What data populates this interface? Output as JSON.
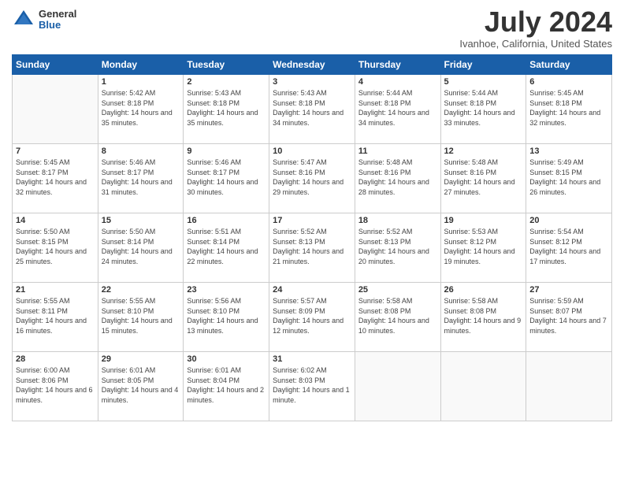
{
  "header": {
    "logo": {
      "general": "General",
      "blue": "Blue"
    },
    "title": "July 2024",
    "location": "Ivanhoe, California, United States"
  },
  "days_of_week": [
    "Sunday",
    "Monday",
    "Tuesday",
    "Wednesday",
    "Thursday",
    "Friday",
    "Saturday"
  ],
  "weeks": [
    [
      {
        "num": "",
        "sunrise": "",
        "sunset": "",
        "daylight": "",
        "empty": true
      },
      {
        "num": "1",
        "sunrise": "Sunrise: 5:42 AM",
        "sunset": "Sunset: 8:18 PM",
        "daylight": "Daylight: 14 hours and 35 minutes."
      },
      {
        "num": "2",
        "sunrise": "Sunrise: 5:43 AM",
        "sunset": "Sunset: 8:18 PM",
        "daylight": "Daylight: 14 hours and 35 minutes."
      },
      {
        "num": "3",
        "sunrise": "Sunrise: 5:43 AM",
        "sunset": "Sunset: 8:18 PM",
        "daylight": "Daylight: 14 hours and 34 minutes."
      },
      {
        "num": "4",
        "sunrise": "Sunrise: 5:44 AM",
        "sunset": "Sunset: 8:18 PM",
        "daylight": "Daylight: 14 hours and 34 minutes."
      },
      {
        "num": "5",
        "sunrise": "Sunrise: 5:44 AM",
        "sunset": "Sunset: 8:18 PM",
        "daylight": "Daylight: 14 hours and 33 minutes."
      },
      {
        "num": "6",
        "sunrise": "Sunrise: 5:45 AM",
        "sunset": "Sunset: 8:18 PM",
        "daylight": "Daylight: 14 hours and 32 minutes."
      }
    ],
    [
      {
        "num": "7",
        "sunrise": "Sunrise: 5:45 AM",
        "sunset": "Sunset: 8:17 PM",
        "daylight": "Daylight: 14 hours and 32 minutes."
      },
      {
        "num": "8",
        "sunrise": "Sunrise: 5:46 AM",
        "sunset": "Sunset: 8:17 PM",
        "daylight": "Daylight: 14 hours and 31 minutes."
      },
      {
        "num": "9",
        "sunrise": "Sunrise: 5:46 AM",
        "sunset": "Sunset: 8:17 PM",
        "daylight": "Daylight: 14 hours and 30 minutes."
      },
      {
        "num": "10",
        "sunrise": "Sunrise: 5:47 AM",
        "sunset": "Sunset: 8:16 PM",
        "daylight": "Daylight: 14 hours and 29 minutes."
      },
      {
        "num": "11",
        "sunrise": "Sunrise: 5:48 AM",
        "sunset": "Sunset: 8:16 PM",
        "daylight": "Daylight: 14 hours and 28 minutes."
      },
      {
        "num": "12",
        "sunrise": "Sunrise: 5:48 AM",
        "sunset": "Sunset: 8:16 PM",
        "daylight": "Daylight: 14 hours and 27 minutes."
      },
      {
        "num": "13",
        "sunrise": "Sunrise: 5:49 AM",
        "sunset": "Sunset: 8:15 PM",
        "daylight": "Daylight: 14 hours and 26 minutes."
      }
    ],
    [
      {
        "num": "14",
        "sunrise": "Sunrise: 5:50 AM",
        "sunset": "Sunset: 8:15 PM",
        "daylight": "Daylight: 14 hours and 25 minutes."
      },
      {
        "num": "15",
        "sunrise": "Sunrise: 5:50 AM",
        "sunset": "Sunset: 8:14 PM",
        "daylight": "Daylight: 14 hours and 24 minutes."
      },
      {
        "num": "16",
        "sunrise": "Sunrise: 5:51 AM",
        "sunset": "Sunset: 8:14 PM",
        "daylight": "Daylight: 14 hours and 22 minutes."
      },
      {
        "num": "17",
        "sunrise": "Sunrise: 5:52 AM",
        "sunset": "Sunset: 8:13 PM",
        "daylight": "Daylight: 14 hours and 21 minutes."
      },
      {
        "num": "18",
        "sunrise": "Sunrise: 5:52 AM",
        "sunset": "Sunset: 8:13 PM",
        "daylight": "Daylight: 14 hours and 20 minutes."
      },
      {
        "num": "19",
        "sunrise": "Sunrise: 5:53 AM",
        "sunset": "Sunset: 8:12 PM",
        "daylight": "Daylight: 14 hours and 19 minutes."
      },
      {
        "num": "20",
        "sunrise": "Sunrise: 5:54 AM",
        "sunset": "Sunset: 8:12 PM",
        "daylight": "Daylight: 14 hours and 17 minutes."
      }
    ],
    [
      {
        "num": "21",
        "sunrise": "Sunrise: 5:55 AM",
        "sunset": "Sunset: 8:11 PM",
        "daylight": "Daylight: 14 hours and 16 minutes."
      },
      {
        "num": "22",
        "sunrise": "Sunrise: 5:55 AM",
        "sunset": "Sunset: 8:10 PM",
        "daylight": "Daylight: 14 hours and 15 minutes."
      },
      {
        "num": "23",
        "sunrise": "Sunrise: 5:56 AM",
        "sunset": "Sunset: 8:10 PM",
        "daylight": "Daylight: 14 hours and 13 minutes."
      },
      {
        "num": "24",
        "sunrise": "Sunrise: 5:57 AM",
        "sunset": "Sunset: 8:09 PM",
        "daylight": "Daylight: 14 hours and 12 minutes."
      },
      {
        "num": "25",
        "sunrise": "Sunrise: 5:58 AM",
        "sunset": "Sunset: 8:08 PM",
        "daylight": "Daylight: 14 hours and 10 minutes."
      },
      {
        "num": "26",
        "sunrise": "Sunrise: 5:58 AM",
        "sunset": "Sunset: 8:08 PM",
        "daylight": "Daylight: 14 hours and 9 minutes."
      },
      {
        "num": "27",
        "sunrise": "Sunrise: 5:59 AM",
        "sunset": "Sunset: 8:07 PM",
        "daylight": "Daylight: 14 hours and 7 minutes."
      }
    ],
    [
      {
        "num": "28",
        "sunrise": "Sunrise: 6:00 AM",
        "sunset": "Sunset: 8:06 PM",
        "daylight": "Daylight: 14 hours and 6 minutes."
      },
      {
        "num": "29",
        "sunrise": "Sunrise: 6:01 AM",
        "sunset": "Sunset: 8:05 PM",
        "daylight": "Daylight: 14 hours and 4 minutes."
      },
      {
        "num": "30",
        "sunrise": "Sunrise: 6:01 AM",
        "sunset": "Sunset: 8:04 PM",
        "daylight": "Daylight: 14 hours and 2 minutes."
      },
      {
        "num": "31",
        "sunrise": "Sunrise: 6:02 AM",
        "sunset": "Sunset: 8:03 PM",
        "daylight": "Daylight: 14 hours and 1 minute."
      },
      {
        "num": "",
        "sunrise": "",
        "sunset": "",
        "daylight": "",
        "empty": true
      },
      {
        "num": "",
        "sunrise": "",
        "sunset": "",
        "daylight": "",
        "empty": true
      },
      {
        "num": "",
        "sunrise": "",
        "sunset": "",
        "daylight": "",
        "empty": true
      }
    ]
  ]
}
